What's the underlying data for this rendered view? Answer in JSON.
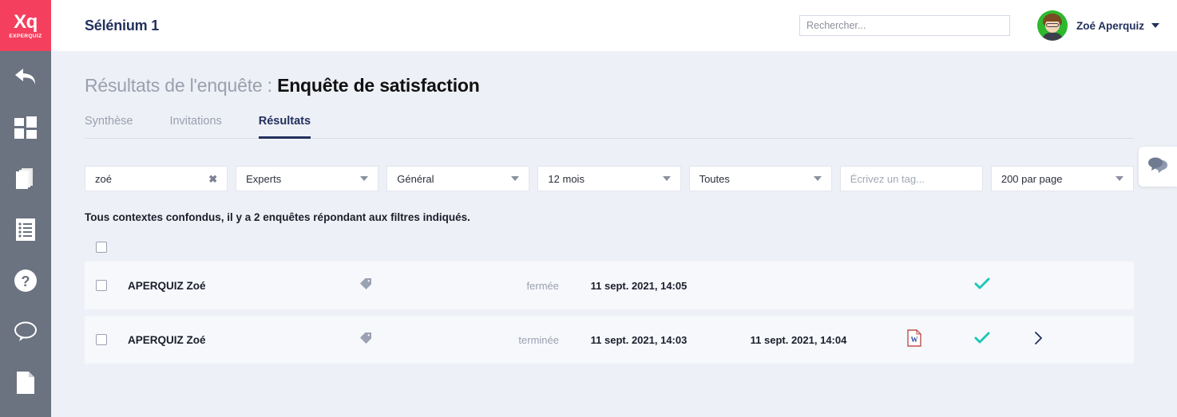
{
  "brand": {
    "logo_main": "Xq",
    "logo_sub": "EXPERQUIZ",
    "logo_bg": "#f4405e",
    "sidebar_bg": "#6b7280",
    "accent_navy": "#22305c",
    "accent_teal": "#1ec8b5",
    "page_bg": "#eef0f7",
    "row_bg": "#f7f8fc"
  },
  "sidebar": {
    "items": [
      {
        "name": "back-arrow-icon",
        "label": "Retour"
      },
      {
        "name": "dashboard-icon",
        "label": "Tableau de bord"
      },
      {
        "name": "books-icon",
        "label": "Bibliothèque"
      },
      {
        "name": "list-document-icon",
        "label": "Listes"
      },
      {
        "name": "help-icon",
        "label": "Aide"
      },
      {
        "name": "chat-bubble-icon",
        "label": "Messages"
      },
      {
        "name": "page-icon",
        "label": "Documents"
      }
    ]
  },
  "topbar": {
    "app_title": "Sélénium 1",
    "search_placeholder": "Rechercher...",
    "search_value": "",
    "user_name": "Zoé Aperquiz"
  },
  "page": {
    "title_prefix": "Résultats de l'enquête : ",
    "title_main": "Enquête de satisfaction"
  },
  "tabs": [
    {
      "label": "Synthèse",
      "active": false
    },
    {
      "label": "Invitations",
      "active": false
    },
    {
      "label": "Résultats",
      "active": true
    }
  ],
  "filters": {
    "search_value": "zoé",
    "clear_icon": "✖",
    "experts": "Experts",
    "general": "Général",
    "months": "12 mois",
    "all": "Toutes",
    "tag_placeholder": "Écrivez un tag...",
    "per_page": "200 par page"
  },
  "summary": "Tous contextes confondus, il y a 2 enquêtes répondant aux filtres indiquées.",
  "summary_text": "Tous contextes confondus, il y a 2 enquêtes répondant aux filtres indiqués.",
  "rows": [
    {
      "name": "APERQUIZ Zoé",
      "status": "fermée",
      "date1": "11 sept. 2021, 14:05",
      "date2": "",
      "has_doc": false,
      "has_check": true,
      "has_more": false
    },
    {
      "name": "APERQUIZ Zoé",
      "status": "terminée",
      "date1": "11 sept. 2021, 14:03",
      "date2": "11 sept. 2021, 14:04",
      "has_doc": true,
      "has_check": true,
      "has_more": true
    }
  ]
}
